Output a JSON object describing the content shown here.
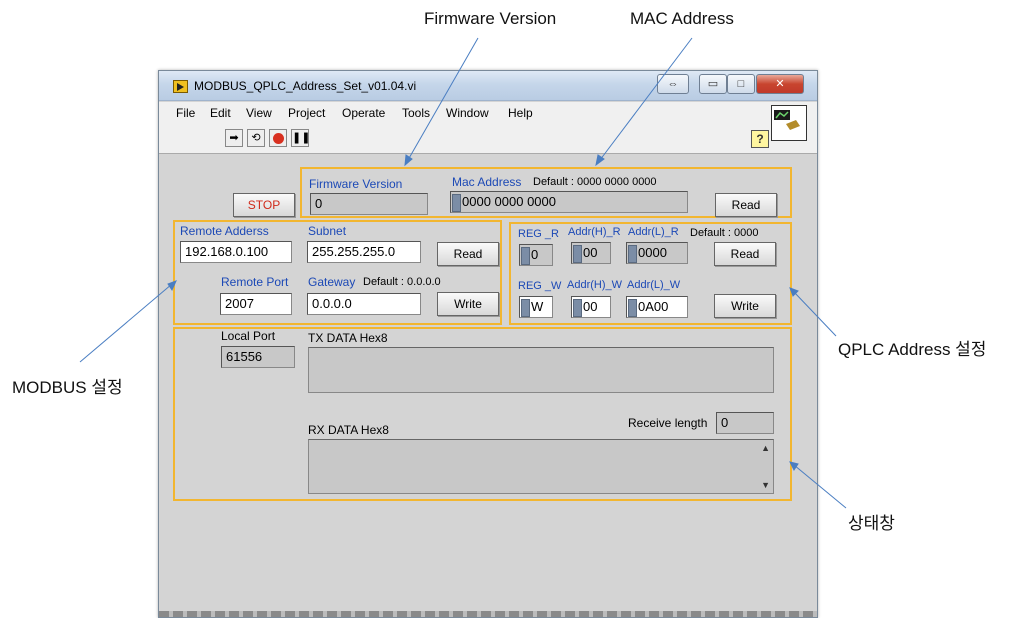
{
  "callouts": {
    "firmware": "Firmware Version",
    "mac": "MAC Address",
    "modbus": "MODBUS 설정",
    "qplc": "QPLC Address 설정",
    "status": "상태창"
  },
  "window": {
    "title": "MODBUS_QPLC_Address_Set_v01.04.vi",
    "controls": {
      "restore": "⇔",
      "minimize": "▭",
      "maximize": "□",
      "close": "✕"
    }
  },
  "menu": [
    "File",
    "Edit",
    "View",
    "Project",
    "Operate",
    "Tools",
    "Window",
    "Help"
  ],
  "toolbar": {
    "icons": [
      "run-arrow-icon",
      "run-continuous-icon",
      "abort-icon",
      "pause-icon"
    ],
    "help": "?"
  },
  "stop_button": "STOP",
  "firmware_section": {
    "firmware_label": "Firmware Version",
    "firmware_value": "0",
    "mac_label": "Mac Address",
    "mac_default": "Default : 0000 0000 0000",
    "mac_value": "0000 0000 0000",
    "read_button": "Read"
  },
  "modbus_section": {
    "remote_address_label": "Remote Adderss",
    "remote_address_value": "192.168.0.100",
    "subnet_label": "Subnet",
    "subnet_value": "255.255.255.0",
    "read_button": "Read",
    "remote_port_label": "Remote Port",
    "remote_port_value": "2007",
    "gateway_label": "Gateway",
    "gateway_default": "Default : 0.0.0.0",
    "gateway_value": "0.0.0.0",
    "write_button": "Write"
  },
  "qplc_section": {
    "reg_r_label": "REG _R",
    "reg_r_value": "0",
    "addr_h_r_label": "Addr(H)_R",
    "addr_h_r_value": "00",
    "addr_l_r_label": "Addr(L)_R",
    "addr_l_r_value": "0000",
    "default_label": "Default : 0000",
    "read_button": "Read",
    "reg_w_label": "REG _W",
    "reg_w_value": "W",
    "addr_h_w_label": "Addr(H)_W",
    "addr_h_w_value": "00",
    "addr_l_w_label": "Addr(L)_W",
    "addr_l_w_value": "0A00",
    "write_button": "Write"
  },
  "status_section": {
    "local_port_label": "Local Port",
    "local_port_value": "61556",
    "tx_label": "TX DATA Hex8",
    "tx_value": "",
    "rx_label": "RX DATA Hex8",
    "rx_value": "",
    "receive_length_label": "Receive length",
    "receive_length_value": "0"
  },
  "colors": {
    "highlight_border": "#f2b630",
    "label_blue": "#1c49b6",
    "panel_bg": "#d4d4d4",
    "stop_text": "#d02a1a"
  }
}
